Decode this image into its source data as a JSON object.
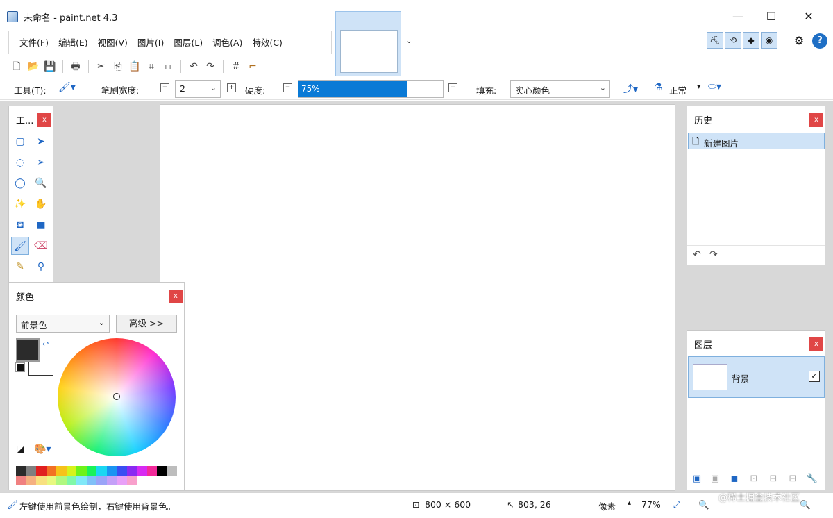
{
  "window": {
    "title": "未命名 - paint.net 4.3",
    "minimize": "—",
    "maximize": "☐",
    "close": "✕"
  },
  "menu": [
    "文件(F)",
    "编辑(E)",
    "视图(V)",
    "图片(I)",
    "图层(L)",
    "调色(A)",
    "特效(C)"
  ],
  "toolbar2": {
    "tool_label": "工具(T):",
    "brush_width_label": "笔刷宽度:",
    "brush_width_value": "2",
    "hardness_label": "硬度:",
    "hardness_value": "75%",
    "hardness_level": 0.75,
    "fill_label": "填充:",
    "fill_value": "实心颜色",
    "blend_label": "正常"
  },
  "tools_panel": {
    "title": "工...",
    "close": "x"
  },
  "colors_panel": {
    "title": "颜色",
    "close": "x",
    "target_select": "前景色",
    "advanced_button": "高级 >>",
    "primary_color": "#2b2b2b",
    "secondary_color": "#ffffff",
    "palette": [
      "#2b2b2b",
      "#7f7f7f",
      "#e02020",
      "#f27024",
      "#f6c21a",
      "#d7f21a",
      "#6ef21a",
      "#1af25a",
      "#1ad7f2",
      "#1a94f2",
      "#3a4ef2",
      "#8a2af2",
      "#d72af2",
      "#f22a9a",
      "#000000",
      "#bdbdbd",
      "#f08080",
      "#f5b080",
      "#f8e080",
      "#e8f880",
      "#b0f880",
      "#80f8a8",
      "#80e8f8",
      "#80c0f8",
      "#9aa4f8",
      "#c4a0f8",
      "#e8a0f8",
      "#f8a0cc"
    ]
  },
  "history_panel": {
    "title": "历史",
    "close": "x",
    "items": [
      "新建图片"
    ]
  },
  "layers_panel": {
    "title": "图层",
    "close": "x",
    "layers": [
      {
        "name": "背景",
        "visible": "✓"
      }
    ]
  },
  "status": {
    "hint": "左键使用前景色绘制，右键使用背景色。",
    "image_size": "800 × 600",
    "cursor_pos": "803, 26",
    "units": "像素",
    "zoom": "77%"
  },
  "watermark": "@稀土掘金技术社区"
}
